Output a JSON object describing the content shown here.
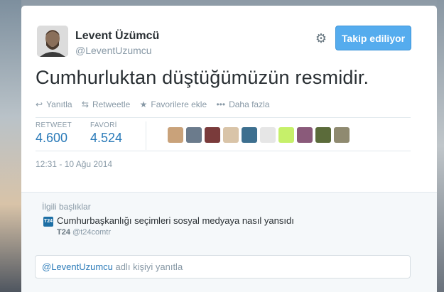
{
  "user": {
    "name": "Levent Üzümcü",
    "handle": "@LeventUzumcu",
    "follow_label": "Takip ediliyor"
  },
  "tweet": {
    "text": "Cumhurluktan düştüğümüzün resmidir.",
    "timestamp": "12:31 - 10 Ağu 2014"
  },
  "actions": [
    {
      "icon": "reply-icon",
      "label": "Yanıtla"
    },
    {
      "icon": "retweet-icon",
      "label": "Retweetle"
    },
    {
      "icon": "star-icon",
      "label": "Favorilere ekle"
    },
    {
      "icon": "more-icon",
      "label": "Daha fazla"
    }
  ],
  "stats": {
    "retweet_label": "RETWEET",
    "retweet_count": "4.600",
    "favori_label": "FAVORİ",
    "favori_count": "4.524"
  },
  "faved_by_colors": [
    "#c9a27a",
    "#6b7b8c",
    "#7a3b3b",
    "#d9c4a8",
    "#3d6f8f",
    "#e6e6e6",
    "#c6f06a",
    "#8a5a7a",
    "#5b6b3a",
    "#8f8a70"
  ],
  "related": {
    "title": "İlgili başlıklar",
    "icon_text": "T24",
    "headline": "Cumhurbaşkanlığı seçimleri sosyal medyaya nasıl yansıdı",
    "source_name": "T24",
    "source_handle": "@t24comtr"
  },
  "reply": {
    "mention": "@LeventUzumcu",
    "placeholder_suffix": " adlı kişiyi yanıtla"
  },
  "colors": {
    "accent": "#55acee",
    "link": "#2b7bb9",
    "muted": "#8899a6"
  }
}
